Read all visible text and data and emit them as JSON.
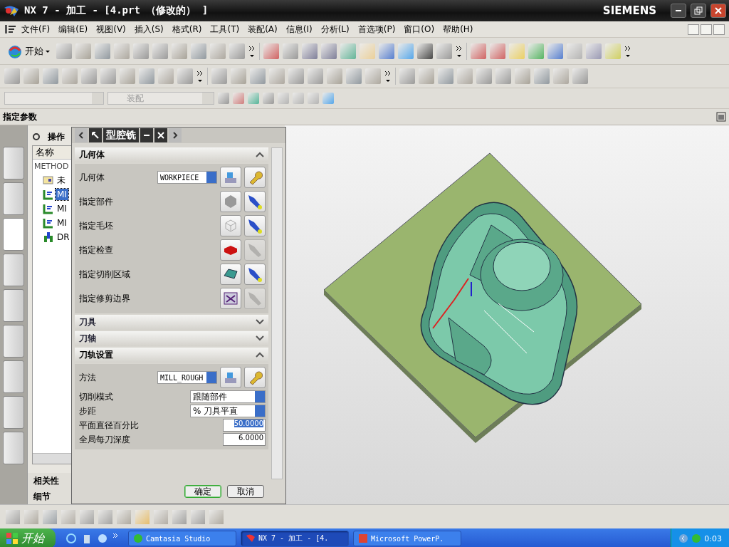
{
  "window": {
    "title": "NX 7 - 加工 - [4.prt （修改的） ]",
    "brand": "SIEMENS"
  },
  "menu": [
    "文件(F)",
    "编辑(E)",
    "视图(V)",
    "插入(S)",
    "格式(R)",
    "工具(T)",
    "装配(A)",
    "信息(I)",
    "分析(L)",
    "首选项(P)",
    "窗口(O)",
    "帮助(H)"
  ],
  "toolbar": {
    "start_label": "开始",
    "filter_combo": {
      "value": "装配",
      "disabled": true
    }
  },
  "cue_line": "指定参数",
  "resource_bar": [
    {
      "selected": false
    },
    {
      "selected": false
    },
    {
      "selected": true
    },
    {
      "selected": false
    },
    {
      "selected": false
    },
    {
      "selected": false
    },
    {
      "selected": false
    },
    {
      "selected": false
    },
    {
      "selected": false
    }
  ],
  "navigator": {
    "title": "操作",
    "column": "名称",
    "root": "METHOD",
    "items": [
      {
        "label": "未",
        "kind": "folder",
        "selected": false
      },
      {
        "label": "MI",
        "kind": "operation",
        "selected": true
      },
      {
        "label": "MI",
        "kind": "operation",
        "selected": false
      },
      {
        "label": "MI",
        "kind": "operation",
        "selected": false
      },
      {
        "label": "DR",
        "kind": "drill",
        "selected": false
      }
    ],
    "panels": [
      "相关性",
      "细节"
    ]
  },
  "dialog": {
    "title": "型腔铣",
    "sections": [
      {
        "title": "几何体",
        "expanded": true,
        "rows": [
          {
            "label": "几何体",
            "kind": "dropdown",
            "value": "WORKPIECE"
          },
          {
            "label": "指定部件",
            "kind": "select",
            "display_enabled": true
          },
          {
            "label": "指定毛坯",
            "kind": "select",
            "display_enabled": true
          },
          {
            "label": "指定检查",
            "kind": "select",
            "display_enabled": false
          },
          {
            "label": "指定切削区域",
            "kind": "select",
            "display_enabled": true
          },
          {
            "label": "指定修剪边界",
            "kind": "select",
            "display_enabled": false
          }
        ]
      },
      {
        "title": "刀具",
        "expanded": false
      },
      {
        "title": "刀轴",
        "expanded": false
      },
      {
        "title": "刀轨设置",
        "expanded": true,
        "rows": [
          {
            "label": "方法",
            "kind": "dropdown",
            "value": "MILL_ROUGH"
          },
          {
            "label": "切削模式",
            "kind": "wide_dropdown",
            "value": "跟随部件"
          },
          {
            "label": "步距",
            "kind": "wide_dropdown",
            "value": "% 刀具平直"
          },
          {
            "label": "平面直径百分比",
            "kind": "number",
            "value": "50.0000",
            "selected": true
          },
          {
            "label": "全局每刀深度",
            "kind": "number",
            "value": "6.0000",
            "selected": false
          }
        ]
      }
    ],
    "buttons": [
      "确定",
      "取消"
    ]
  },
  "taskbar": {
    "start": "开始",
    "tasks": [
      {
        "label": "Camtasia Studio",
        "selected": false
      },
      {
        "label": "NX 7 - 加工 - [4.",
        "selected": true
      },
      {
        "label": "Microsoft PowerP.",
        "selected": false
      }
    ],
    "clock": "0:03"
  }
}
